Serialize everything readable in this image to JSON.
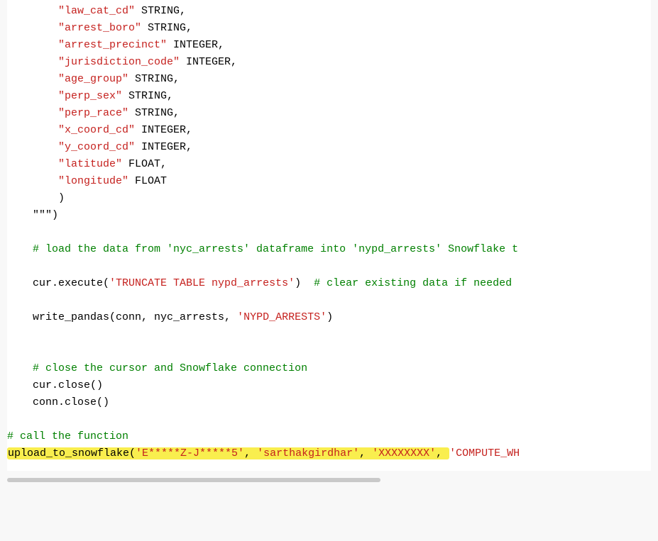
{
  "col_defs": [
    {
      "name": "\"law_cat_cd\"",
      "type": " STRING,"
    },
    {
      "name": "\"arrest_boro\"",
      "type": " STRING,"
    },
    {
      "name": "\"arrest_precinct\"",
      "type": " INTEGER,"
    },
    {
      "name": "\"jurisdiction_code\"",
      "type": " INTEGER,"
    },
    {
      "name": "\"age_group\"",
      "type": " STRING,"
    },
    {
      "name": "\"perp_sex\"",
      "type": " STRING,"
    },
    {
      "name": "\"perp_race\"",
      "type": " STRING,"
    },
    {
      "name": "\"x_coord_cd\"",
      "type": " INTEGER,"
    },
    {
      "name": "\"y_coord_cd\"",
      "type": " INTEGER,"
    },
    {
      "name": "\"latitude\"",
      "type": " FLOAT,"
    },
    {
      "name": "\"longitude\"",
      "type": " FLOAT"
    }
  ],
  "close_paren": "        )",
  "triple_close": "    \"\"\")",
  "comment_load": "    # load the data from 'nyc_arrests' dataframe into 'nypd_arrests' Snowflake t",
  "truncate_prefix": "    cur.execute(",
  "truncate_str": "'TRUNCATE TABLE nypd_arrests'",
  "truncate_suffix": ")  ",
  "truncate_cmt": "# clear existing data if needed",
  "write_prefix": "    write_pandas(conn, nyc_arrests, ",
  "write_str": "'NYPD_ARRESTS'",
  "write_suffix": ")",
  "comment_close": "    # close the cursor and Snowflake connection",
  "cur_close": "    cur.close()",
  "conn_close": "    conn.close()",
  "comment_call": "# call the function",
  "call_fn": "upload_to_snowflake(",
  "call_arg1": "'E*****Z-J*****5'",
  "call_sep": ", ",
  "call_arg2": "'sarthakgirdhar'",
  "call_arg3": "'XXXXXXXX'",
  "call_arg4": "'COMPUTE_WH"
}
